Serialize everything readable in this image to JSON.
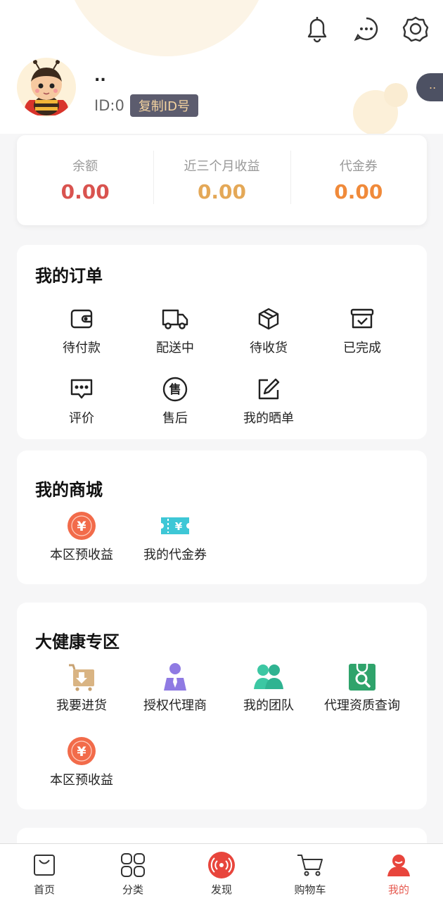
{
  "header": {
    "icons": [
      "bell-icon",
      "message-icon",
      "settings-icon"
    ],
    "side_pill_text": ".."
  },
  "profile": {
    "nickname": "..",
    "id_text": "ID:0",
    "copy_button_label": "复制ID号"
  },
  "stats": [
    {
      "label": "余额",
      "value": "0.00",
      "color": "#d9534f"
    },
    {
      "label": "近三个月收益",
      "value": "0.00",
      "color": "#e4a857"
    },
    {
      "label": "代金券",
      "value": "0.00",
      "color": "#f08a3a"
    }
  ],
  "orders": {
    "title": "我的订单",
    "items": [
      {
        "label": "待付款",
        "icon": "wallet-icon"
      },
      {
        "label": "配送中",
        "icon": "truck-icon"
      },
      {
        "label": "待收货",
        "icon": "box-icon"
      },
      {
        "label": "已完成",
        "icon": "completed-box-icon"
      },
      {
        "label": "评价",
        "icon": "comment-icon"
      },
      {
        "label": "售后",
        "icon": "after-sale-icon"
      },
      {
        "label": "我的晒单",
        "icon": "edit-icon"
      }
    ]
  },
  "mall": {
    "title": "我的商城",
    "items": [
      {
        "label": "本区预收益",
        "icon": "yen-coin-icon"
      },
      {
        "label": "我的代金券",
        "icon": "coupon-icon"
      }
    ]
  },
  "health": {
    "title": "大健康专区",
    "items": [
      {
        "label": "我要进货",
        "icon": "restock-cart-icon"
      },
      {
        "label": "授权代理商",
        "icon": "agent-person-icon"
      },
      {
        "label": "我的团队",
        "icon": "team-icon"
      },
      {
        "label": "代理资质查询",
        "icon": "search-bag-icon"
      },
      {
        "label": "本区预收益",
        "icon": "yen-coin-icon"
      }
    ]
  },
  "tabbar": {
    "items": [
      {
        "label": "首页",
        "icon": "home-bag-icon"
      },
      {
        "label": "分类",
        "icon": "category-icon"
      },
      {
        "label": "发现",
        "icon": "discover-icon"
      },
      {
        "label": "购物车",
        "icon": "cart-icon"
      },
      {
        "label": "我的",
        "icon": "profile-icon"
      }
    ],
    "active_color": "#e65a50"
  }
}
